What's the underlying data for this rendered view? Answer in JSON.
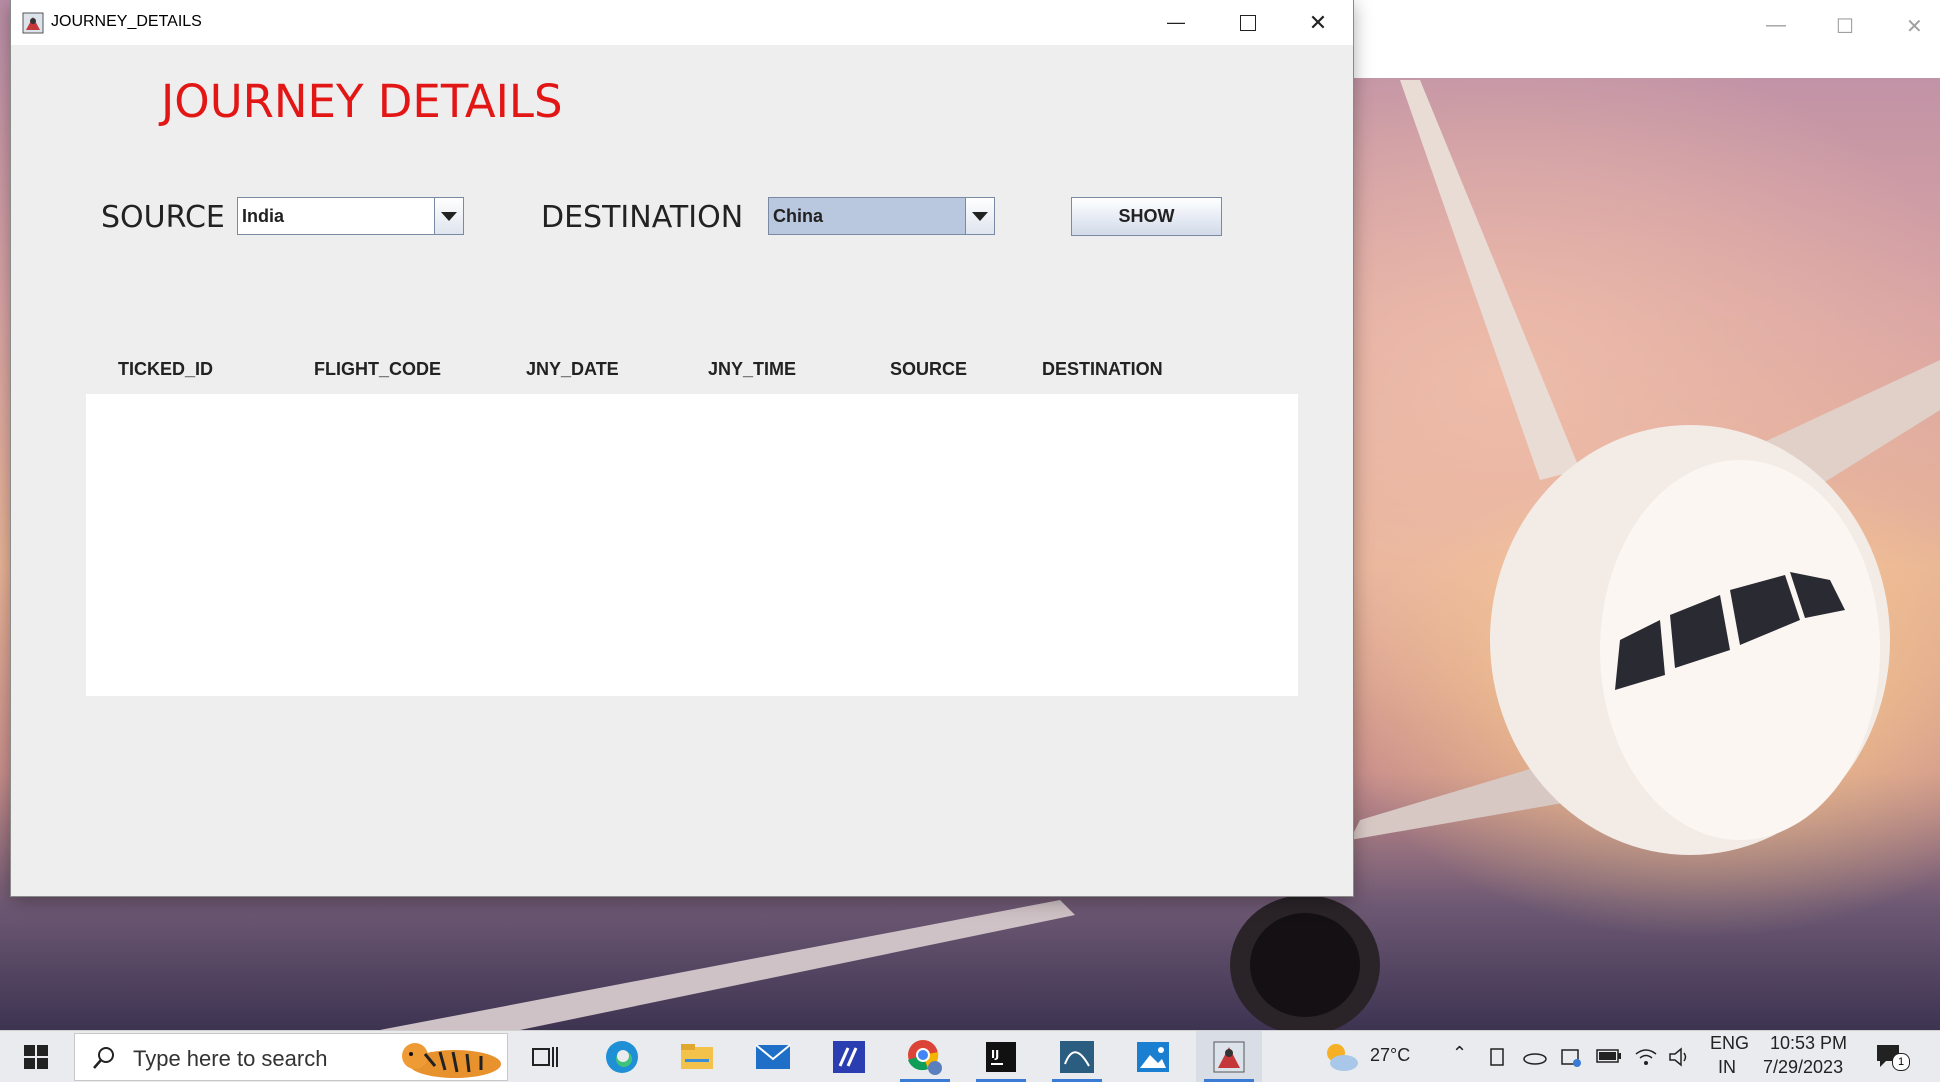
{
  "window": {
    "title": "JOURNEY_DETAILS",
    "heading": "JOURNEY DETAILS"
  },
  "form": {
    "source_label": "SOURCE",
    "source_value": "India",
    "destination_label": "DESTINATION",
    "destination_value": "China",
    "show_label": "SHOW"
  },
  "table": {
    "columns": [
      "TICKED_ID",
      "FLIGHT_CODE",
      "JNY_DATE",
      "JNY_TIME",
      "SOURCE",
      "DESTINATION"
    ],
    "rows": []
  },
  "taskbar": {
    "search_placeholder": "Type here to search",
    "weather_temp": "27°C",
    "language": "ENG",
    "region": "IN",
    "time": "10:53 PM",
    "date": "7/29/2023",
    "notification_count": "1"
  },
  "colors": {
    "heading": "#e31616",
    "window_bg": "#eeeeee",
    "destination_combo_bg": "#b9c8de"
  }
}
